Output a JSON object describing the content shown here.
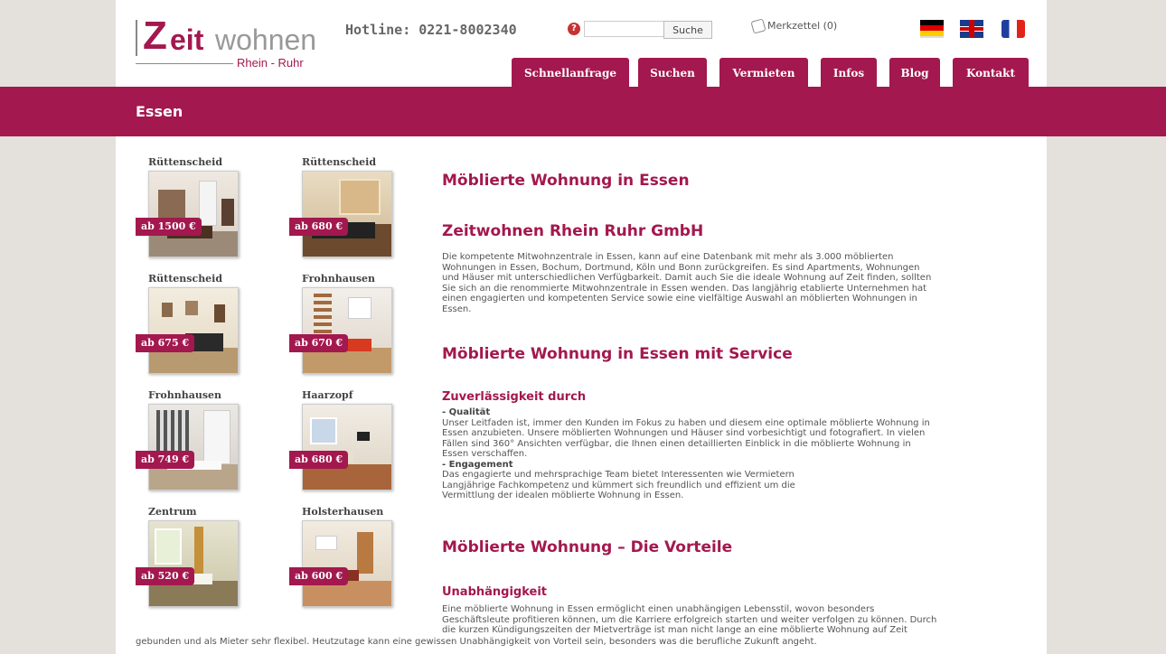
{
  "header": {
    "logo": {
      "z": "Z",
      "eit": "eit",
      "wohnen": "wohnen",
      "sub": "Rhein - Ruhr"
    },
    "hotline": "Hotline: 0221-8002340",
    "search": {
      "placeholder": "",
      "button": "Suche"
    },
    "merkzettel": "Merkzettel (0)",
    "flags": [
      "de-flag-icon",
      "uk-flag-icon",
      "fr-flag-icon"
    ]
  },
  "nav": [
    {
      "label": "Schnellanfrage"
    },
    {
      "label": "Suchen"
    },
    {
      "label": "Vermieten"
    },
    {
      "label": "Infos"
    },
    {
      "label": "Blog"
    },
    {
      "label": "Kontakt"
    }
  ],
  "page_title": "Essen",
  "listings": [
    {
      "district": "Rüttenscheid",
      "price": "ab 1500 €"
    },
    {
      "district": "Rüttenscheid",
      "price": "ab 680 €"
    },
    {
      "district": "Rüttenscheid",
      "price": "ab 675 €"
    },
    {
      "district": "Frohnhausen",
      "price": "ab 670 €"
    },
    {
      "district": "Frohnhausen",
      "price": "ab 749 €"
    },
    {
      "district": "Haarzopf",
      "price": "ab 680 €"
    },
    {
      "district": "Zentrum",
      "price": "ab 520 €"
    },
    {
      "district": "Holsterhausen",
      "price": "ab 600 €"
    }
  ],
  "content": {
    "h1": "Möblierte Wohnung in Essen",
    "h2_company": "Zeitwohnen Rhein Ruhr GmbH",
    "p1": [
      "Die kompetente Mitwohnzentrale in Essen, kann auf eine Datenbank mit mehr als 3.000 möblierten",
      "Wohnungen in Essen, Bochum, Dortmund, Köln und Bonn zurückgreifen. Es sind Apartments, Wohnungen",
      "und Häuser mit unterschiedlichen Verfügbarkeit.  Damit auch Sie die ideale Wohnung auf Zeit finden, sollten",
      "Sie sich an die renommierte Mitwohnzentrale in Essen wenden. Das langjährig etablierte Unternehmen hat",
      "einen engagierten und kompetenten Service sowie eine vielfältige Auswahl an möblierten Wohnungen in",
      "Essen."
    ],
    "h2_service": "Möblierte Wohnung in Essen mit Service",
    "h3_zuverl": "Zuverlässigkeit durch",
    "qualitaet_title": "- Qualität",
    "p2": [
      "Unser Leitfaden ist,  immer den Kunden im Fokus zu haben und diesem eine optimale möblierte Wohnung in",
      "Essen anzubieten. Unsere möblierten Wohnungen und Häuser sind vorbesichtigt und fotografiert. In vielen",
      "Fällen sind 360° Ansichten verfügbar, die Ihnen einen detaillierten Einblick in die möblierte Wohnung in",
      "Essen verschaffen."
    ],
    "engagement_title": "- Engagement",
    "p3": [
      "Das engagierte und mehrsprachige Team bietet Interessenten wie Vermietern",
      "Langjährige Fachkompetenz  und kümmert sich freundlich und effizient um die",
      "Vermittlung der idealen möblierte Wohnung in Essen."
    ],
    "h2_vorteile": "Möblierte Wohnung – Die Vorteile",
    "h3_unabh": "Unabhängigkeit",
    "p4": [
      "Eine möblierte Wohnung in Essen ermöglicht einen unabhängigen Lebensstil, wovon besonders",
      "Geschäftsleute profitieren können, um die Karriere erfolgreich starten und weiter verfolgen zu können. Durch",
      "die kurzen Kündigungszeiten der Mietverträge ist man nicht lange an eine möblierte Wohnung auf Zeit"
    ],
    "p4_last": "gebunden und als Mieter sehr flexibel. Heutzutage kann eine gewissen Unabhängigkeit von Vorteil sein, besonders was die berufliche Zukunft angeht."
  }
}
